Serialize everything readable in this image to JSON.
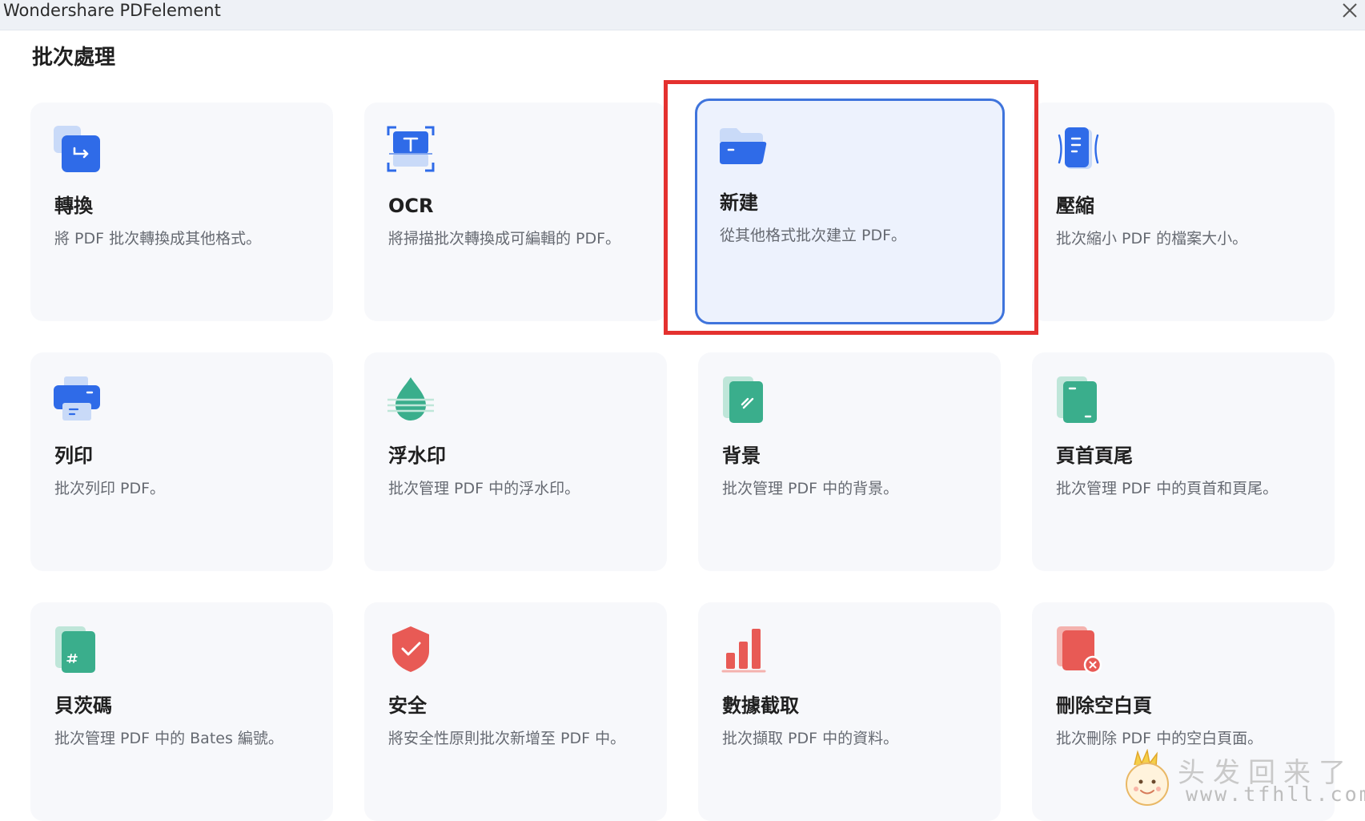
{
  "window": {
    "title": "Wondershare PDFelement"
  },
  "page": {
    "title": "批次處理"
  },
  "colors": {
    "accent": "#3f74dc",
    "highlight_box": "#e4312f",
    "blue_icon": "#2f6be8",
    "green_icon": "#3aae8c",
    "red_icon": "#e85a55"
  },
  "cards": [
    {
      "id": "convert",
      "title": "轉換",
      "desc": "將 PDF 批次轉換成其他格式。",
      "icon": "convert-icon"
    },
    {
      "id": "ocr",
      "title": "OCR",
      "desc": "將掃描批次轉換成可編輯的 PDF。",
      "icon": "ocr-icon"
    },
    {
      "id": "create",
      "title": "新建",
      "desc": "從其他格式批次建立 PDF。",
      "icon": "folder-icon",
      "selected": true
    },
    {
      "id": "compress",
      "title": "壓縮",
      "desc": "批次縮小 PDF 的檔案大小。",
      "icon": "compress-icon"
    },
    {
      "id": "print",
      "title": "列印",
      "desc": "批次列印 PDF。",
      "icon": "printer-icon"
    },
    {
      "id": "watermark",
      "title": "浮水印",
      "desc": "批次管理 PDF 中的浮水印。",
      "icon": "watermark-drop-icon"
    },
    {
      "id": "background",
      "title": "背景",
      "desc": "批次管理 PDF 中的背景。",
      "icon": "background-icon"
    },
    {
      "id": "header-footer",
      "title": "頁首頁尾",
      "desc": "批次管理 PDF 中的頁首和頁尾。",
      "icon": "header-footer-icon"
    },
    {
      "id": "bates",
      "title": "貝茨碼",
      "desc": "批次管理 PDF 中的 Bates 編號。",
      "icon": "bates-number-icon"
    },
    {
      "id": "security",
      "title": "安全",
      "desc": "將安全性原則批次新增至 PDF 中。",
      "icon": "shield-check-icon"
    },
    {
      "id": "data-extract",
      "title": "數據截取",
      "desc": "批次擷取 PDF 中的資料。",
      "icon": "bar-chart-icon"
    },
    {
      "id": "delete-blank",
      "title": "刪除空白頁",
      "desc": "批次刪除 PDF 中的空白頁面。",
      "icon": "delete-page-icon"
    }
  ],
  "watermark_overlay": {
    "line1": "头发回来了",
    "line2": "www.tfhll.com"
  }
}
